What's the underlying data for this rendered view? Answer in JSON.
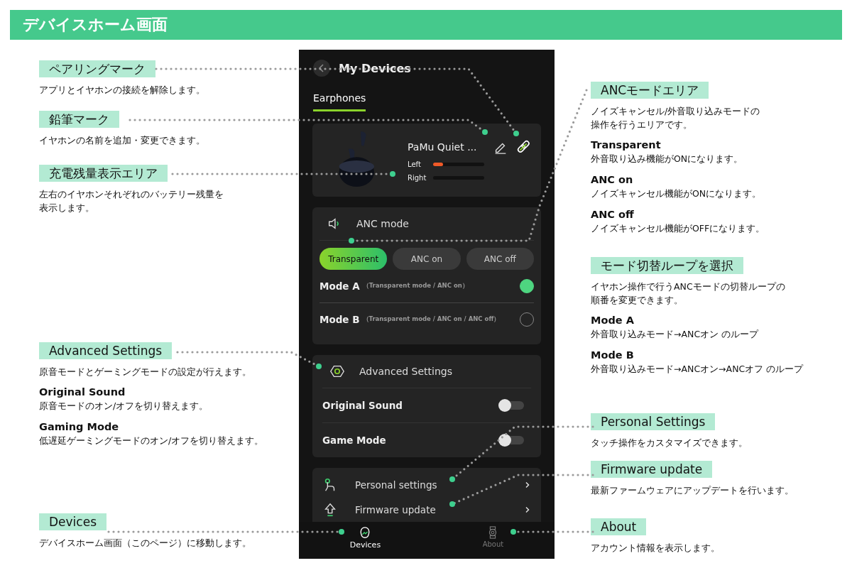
{
  "header": {
    "title": "デバイスホーム画面"
  },
  "left_notes": [
    {
      "label": "ペアリングマーク",
      "lines": [
        "アプリとイヤホンの接続を解除します。"
      ]
    },
    {
      "label": "鉛筆マーク",
      "lines": [
        "イヤホンの名前を追加・変更できます。"
      ]
    },
    {
      "label": "充電残量表示エリア",
      "lines": [
        "左右のイヤホンそれぞれのバッテリー残量を",
        "表示します。"
      ]
    },
    {
      "label": "Advanced Settings",
      "lines": [
        "原音モードとゲーミングモードの設定が行えます。"
      ],
      "items": [
        {
          "title": "Original Sound",
          "text": "原音モードのオン/オフを切り替えます。"
        },
        {
          "title": "Gaming Mode",
          "text": "低遅延ゲーミングモードのオン/オフを切り替えます。"
        }
      ]
    },
    {
      "label": "Devices",
      "lines": [
        "デバイスホーム画面（このページ）に移動します。"
      ]
    }
  ],
  "right_notes": [
    {
      "label": "ANCモードエリア",
      "lines": [
        "ノイズキャンセル/外音取り込みモードの",
        "操作を行うエリアです。"
      ],
      "items": [
        {
          "title": "Transparent",
          "text": "外音取り込み機能がONになります。"
        },
        {
          "title": "ANC on",
          "text": "ノイズキャンセル機能がONになります。"
        },
        {
          "title": "ANC off",
          "text": "ノイズキャンセル機能がOFFになります。"
        }
      ]
    },
    {
      "label": "モード切替ループを選択",
      "lines": [
        "イヤホン操作で行うANCモードの切替ループの",
        "順番を変更できます。"
      ],
      "items": [
        {
          "title": "Mode A",
          "text": "外音取り込みモード→ANCオン のループ"
        },
        {
          "title": "Mode B",
          "text": "外音取り込みモード→ANCオン→ANCオフ のループ"
        }
      ]
    },
    {
      "label": "Personal Settings",
      "lines": [
        "タッチ操作をカスタマイズできます。"
      ]
    },
    {
      "label": "Firmware update",
      "lines": [
        "最新ファームウェアにアップデートを行います。"
      ]
    },
    {
      "label": "About",
      "lines": [
        "アカウント情報を表示します。"
      ]
    }
  ],
  "phone": {
    "title": "My Devices",
    "tabs": [
      {
        "label": "Earphones",
        "selected": true
      }
    ],
    "device": {
      "name": "PaMu Quiet ...",
      "batteries": [
        {
          "label": "Left",
          "level": 0.2
        },
        {
          "label": "Right"
        }
      ]
    },
    "anc": {
      "title": "ANC mode",
      "modes": [
        {
          "label": "Transparent",
          "selected": true
        },
        {
          "label": "ANC on",
          "selected": false
        },
        {
          "label": "ANC off",
          "selected": false
        }
      ],
      "loops": [
        {
          "name": "Mode A",
          "detail": "（Transparent mode / ANC on）",
          "selected": true
        },
        {
          "name": "Mode B",
          "detail": "（Transparent mode / ANC on / ANC off）",
          "selected": false
        }
      ]
    },
    "advanced": {
      "title": "Advanced Settings",
      "toggles": [
        {
          "label": "Original Sound",
          "on": false
        },
        {
          "label": "Game Mode",
          "on": false
        }
      ]
    },
    "menu": [
      {
        "label": "Personal settings"
      },
      {
        "label": "Firmware update"
      }
    ],
    "nav": [
      {
        "label": "Devices",
        "selected": true
      },
      {
        "label": "About",
        "selected": false
      }
    ]
  }
}
